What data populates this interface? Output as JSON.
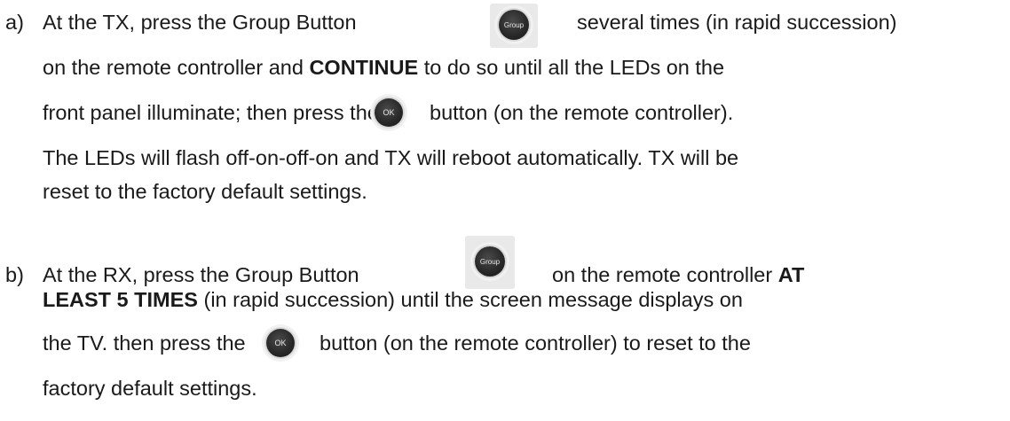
{
  "step_a": {
    "marker": "a)",
    "line1_pre": "At the TX, press the Group Button",
    "line1_post": "several times (in rapid succession)",
    "line2_pre": "on the remote controller and ",
    "line2_bold": "CONTINUE",
    "line2_post": " to do so until all the LEDs on the",
    "line3_pre": "front panel illuminate; then press the",
    "line3_post": "button (on the remote controller).",
    "line4": "The LEDs will flash off-on-off-on and TX will reboot automatically. TX will be",
    "line5": "reset to the factory default settings."
  },
  "step_b": {
    "marker": "b)",
    "line1_pre": "At the RX, press the Group Button",
    "line1_post_pre": "on the remote controller ",
    "line1_post_bold": "AT",
    "line2_bold": "LEAST 5 TIMES",
    "line2_post": " (in rapid succession) until the screen message displays on",
    "line3_pre": "the TV. then press the",
    "line3_post": "button (on the remote controller) to reset to the",
    "line4": "factory default settings."
  },
  "buttons": {
    "group_label": "Group",
    "ok_label": "OK"
  }
}
